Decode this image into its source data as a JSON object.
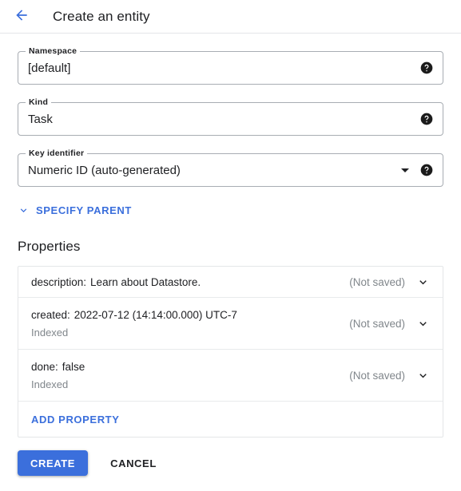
{
  "header": {
    "back_icon": "arrow-left-icon",
    "title": "Create an entity"
  },
  "form": {
    "fields": [
      {
        "label": "Namespace",
        "value": "[default]",
        "help_icon": "help-icon",
        "has_caret": false
      },
      {
        "label": "Kind",
        "value": "Task",
        "help_icon": "help-icon",
        "has_caret": false
      },
      {
        "label": "Key identifier",
        "value": "Numeric ID (auto-generated)",
        "help_icon": "help-icon",
        "has_caret": true
      }
    ],
    "specify_parent": {
      "label": "SPECIFY PARENT",
      "icon": "chevron-down-icon"
    }
  },
  "properties": {
    "heading": "Properties",
    "rows": [
      {
        "name": "description:",
        "value": "Learn about Datastore.",
        "sub": "",
        "status": "(Not saved)",
        "chevron": "chevron-down-icon"
      },
      {
        "name": "created:",
        "value": "2022-07-12 (14:14:00.000) UTC-7",
        "sub": "Indexed",
        "status": "(Not saved)",
        "chevron": "chevron-down-icon"
      },
      {
        "name": "done:",
        "value": "false",
        "sub": "Indexed",
        "status": "(Not saved)",
        "chevron": "chevron-down-icon"
      }
    ],
    "add_property_label": "ADD PROPERTY"
  },
  "actions": {
    "create_label": "CREATE",
    "cancel_label": "CANCEL"
  },
  "colors": {
    "accent_blue": "#3b6fdc",
    "text_primary": "#202124",
    "text_secondary": "#80868b",
    "border": "#a8adb3",
    "divider": "#e4e6e8"
  }
}
